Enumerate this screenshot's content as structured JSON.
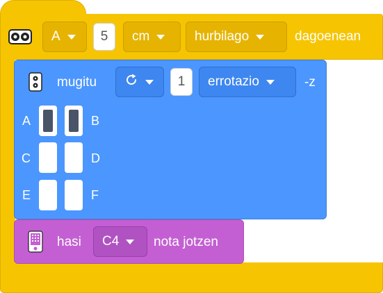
{
  "hat": {
    "port": "A",
    "distance": "5",
    "unit": "cm",
    "comparison": "hurbilago",
    "suffix": "dagoenean"
  },
  "motor": {
    "label": "mugitu",
    "direction_icon": "rotate-clockwise-icon",
    "amount": "1",
    "unit": "errotazio",
    "ports_suffix": "-z",
    "ports": [
      {
        "label": "A",
        "selected": true
      },
      {
        "label": "B",
        "selected": true
      },
      {
        "label": "C",
        "selected": false
      },
      {
        "label": "D",
        "selected": false
      },
      {
        "label": "E",
        "selected": false
      },
      {
        "label": "F",
        "selected": false
      }
    ]
  },
  "sound": {
    "start_label": "hasi",
    "note": "C4",
    "end_label": "nota jotzen"
  },
  "colors": {
    "events": "#F6C400",
    "motion": "#4C97FF",
    "sound": "#C35FD2"
  }
}
